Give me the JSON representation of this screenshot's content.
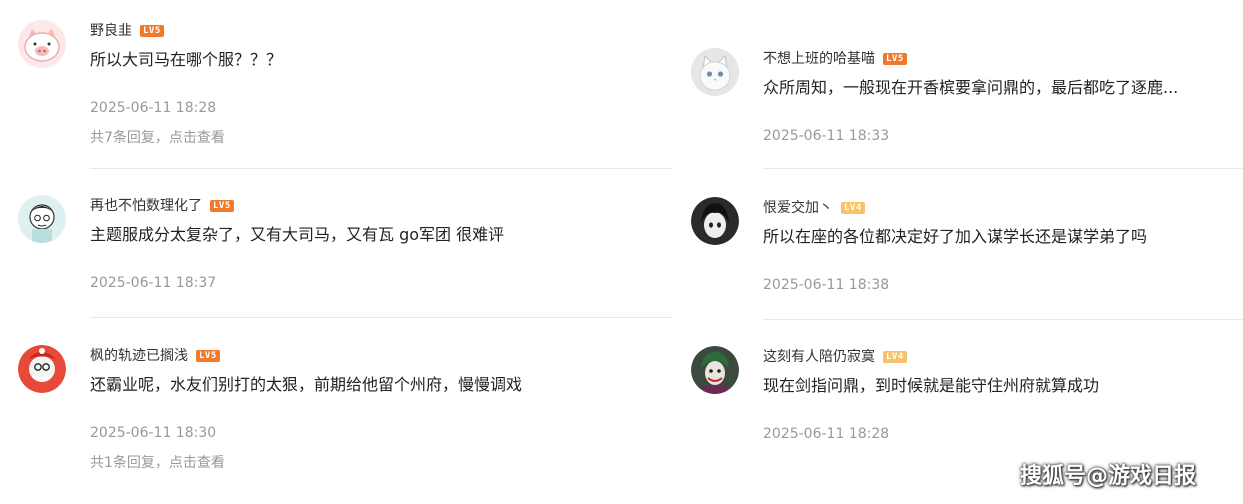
{
  "left": [
    {
      "username": "野良韭",
      "level": "LV5",
      "text": "所以大司马在哪个服？？？",
      "time": "2025-06-11 18:28",
      "reply": "共7条回复，点击查看",
      "avatar": "pig-avatar"
    },
    {
      "username": "再也不怕数理化了",
      "level": "LV5",
      "text": "主题服成分太复杂了，又有大司马，又有瓦 go军团 很难评",
      "time": "2025-06-11 18:37",
      "avatar": "cartoon-avatar"
    },
    {
      "username": "枫的轨迹已搁浅",
      "level": "LV5",
      "text": "还霸业呢，水友们别打的太狠，前期给他留个州府，慢慢调戏",
      "time": "2025-06-11 18:30",
      "reply": "共1条回复，点击查看",
      "avatar": "santa-avatar"
    }
  ],
  "right": [
    {
      "username": "不想上班的哈基喵",
      "level": "LV5",
      "text": "众所周知，一般现在开香槟要拿问鼎的，最后都吃了逐鹿...",
      "time": "2025-06-11 18:33",
      "avatar": "cat-avatar"
    },
    {
      "username": "恨爱交加丶",
      "level": "LV4",
      "text": "所以在座的各位都决定好了加入谋学长还是谋学弟了吗",
      "time": "2025-06-11 18:38",
      "avatar": "anime-avatar"
    },
    {
      "username": "这刻有人陪仍寂寞",
      "level": "LV4",
      "text": "现在剑指问鼎，到时候就是能守住州府就算成功",
      "time": "2025-06-11 18:28",
      "avatar": "joker-avatar"
    }
  ],
  "watermark": "搜狐号@游戏日报",
  "colors": {
    "lv5": "#f07a2a",
    "lv4": "#f6c36a",
    "divider": "#e8e8e8",
    "meta": "#999999"
  }
}
